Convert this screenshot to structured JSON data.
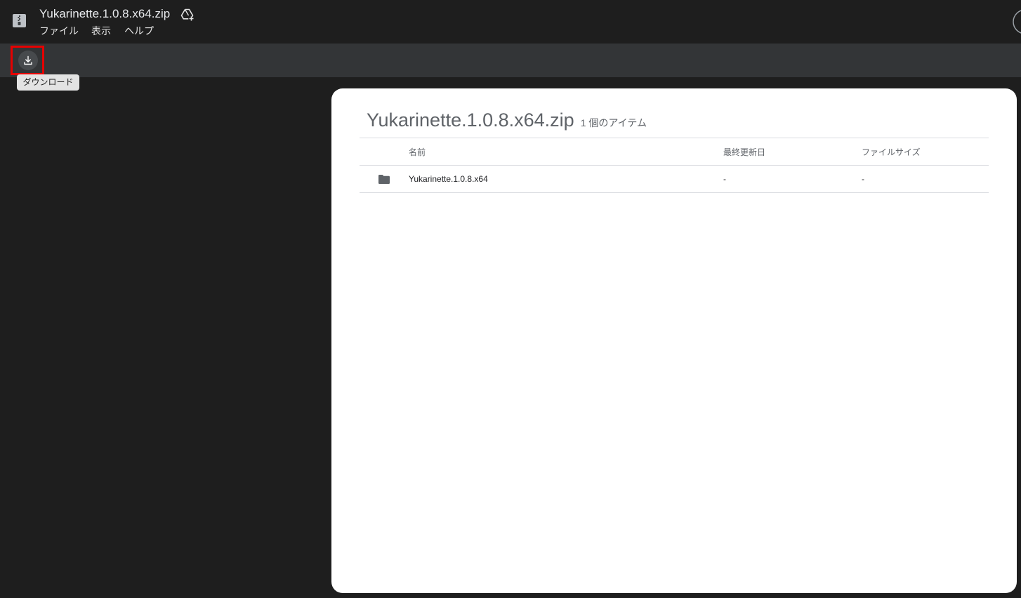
{
  "header": {
    "title": "Yukarinette.1.0.8.x64.zip",
    "file_icon": "zip-file-icon",
    "add_to_drive_icon": "add-to-drive-icon",
    "menu": {
      "file": "ファイル",
      "view": "表示",
      "help": "ヘルプ"
    },
    "account_icon": "avatar-icon"
  },
  "toolbar": {
    "download_icon": "download-icon",
    "tooltip": "ダウンロード"
  },
  "card": {
    "title": "Yukarinette.1.0.8.x64.zip",
    "item_count": "1 個のアイテム",
    "columns": {
      "name": "名前",
      "modified": "最終更新日",
      "size": "ファイルサイズ"
    },
    "rows": [
      {
        "icon": "folder-icon",
        "name": "Yukarinette.1.0.8.x64",
        "modified": "-",
        "size": "-"
      }
    ]
  },
  "colors": {
    "page_background": "#1e1e1e",
    "toolbar_background": "#333537",
    "highlight_border": "#e60000",
    "card_background": "#ffffff"
  }
}
